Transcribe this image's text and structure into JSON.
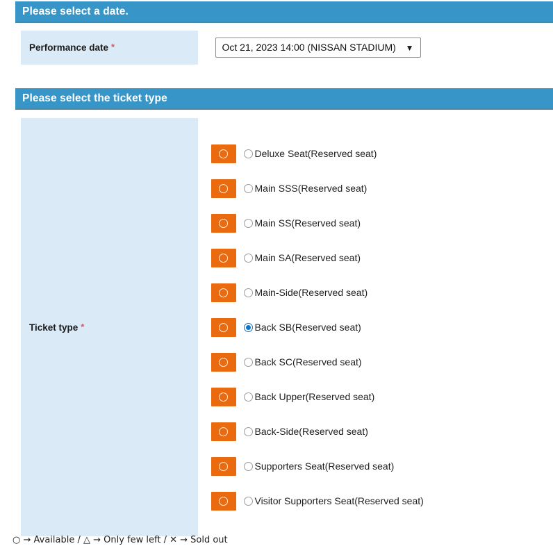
{
  "sections": {
    "date": {
      "heading": "Please select a date.",
      "label": "Performance date",
      "required_mark": "*",
      "select": {
        "selected_value": "Oct 21, 2023 14:00 (NISSAN STADIUM)",
        "arrow_icon": "chevron-down-icon",
        "options": [
          "Oct 21, 2023 14:00 (NISSAN STADIUM)"
        ]
      }
    },
    "ticket_type": {
      "heading": "Please select the ticket type",
      "label": "Ticket type",
      "required_mark": "*",
      "options": [
        {
          "label": "Deluxe Seat(Reserved seat)",
          "status_glyph": "○",
          "status": "Available",
          "selected": false
        },
        {
          "label": "Main SSS(Reserved seat)",
          "status_glyph": "○",
          "status": "Available",
          "selected": false
        },
        {
          "label": "Main SS(Reserved seat)",
          "status_glyph": "○",
          "status": "Available",
          "selected": false
        },
        {
          "label": "Main SA(Reserved seat)",
          "status_glyph": "○",
          "status": "Available",
          "selected": false
        },
        {
          "label": "Main-Side(Reserved seat)",
          "status_glyph": "○",
          "status": "Available",
          "selected": false
        },
        {
          "label": "Back SB(Reserved seat)",
          "status_glyph": "○",
          "status": "Available",
          "selected": true
        },
        {
          "label": "Back SC(Reserved seat)",
          "status_glyph": "○",
          "status": "Available",
          "selected": false
        },
        {
          "label": "Back Upper(Reserved seat)",
          "status_glyph": "○",
          "status": "Available",
          "selected": false
        },
        {
          "label": "Back-Side(Reserved seat)",
          "status_glyph": "○",
          "status": "Available",
          "selected": false
        },
        {
          "label": "Supporters Seat(Reserved seat)",
          "status_glyph": "○",
          "status": "Available",
          "selected": false
        },
        {
          "label": "Visitor Supporters Seat(Reserved seat)",
          "status_glyph": "○",
          "status": "Available",
          "selected": false
        }
      ]
    }
  },
  "legend": {
    "text": "○ → Available / △ → Only few left / ✕ → Sold out"
  },
  "colors": {
    "header_blue": "#3795c8",
    "header_border": "#4b88a4",
    "label_panel": "#daeaf6",
    "status_orange": "#ea6a10",
    "radio_selected": "#1273c4",
    "required_red": "#cf5a69"
  }
}
